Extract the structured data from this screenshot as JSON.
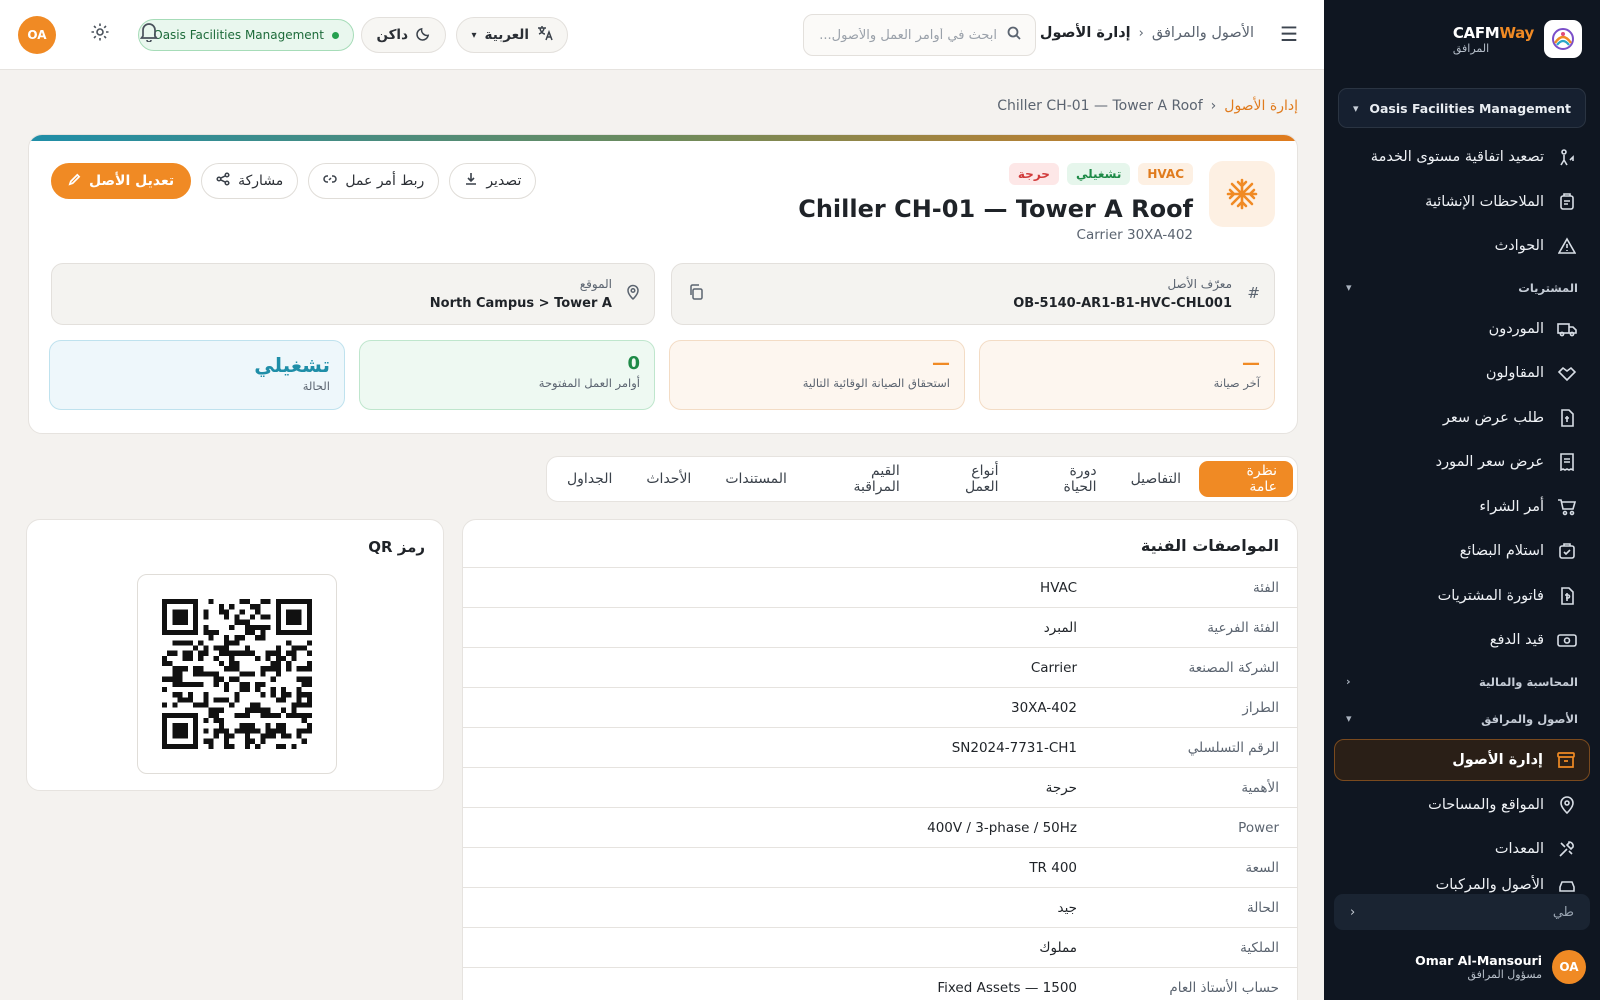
{
  "sidebar": {
    "brand_name_a": "CAFM",
    "brand_name_b": "Way",
    "brand_sub": "المرافق",
    "org": "Oasis Facilities Management",
    "items": [
      {
        "label": "تصعيد اتفاقية مستوى الخدمة",
        "icon": "escalation-icon"
      },
      {
        "label": "الملاحظات الإنشائية",
        "icon": "clipboard-icon"
      },
      {
        "label": "الحوادث",
        "icon": "warning-icon"
      }
    ],
    "section_procurement": "المشتريات",
    "procurement_items": [
      {
        "label": "الموردون",
        "icon": "truck-icon"
      },
      {
        "label": "المقاولون",
        "icon": "handshake-icon"
      },
      {
        "label": "طلب عرض سعر",
        "icon": "file-quote-icon"
      },
      {
        "label": "عرض سعر المورد",
        "icon": "receipt-icon"
      },
      {
        "label": "أمر الشراء",
        "icon": "cart-icon"
      },
      {
        "label": "استلام البضائع",
        "icon": "package-icon"
      },
      {
        "label": "فاتورة المشتريات",
        "icon": "invoice-icon"
      },
      {
        "label": "قيد الدفع",
        "icon": "payment-icon"
      }
    ],
    "section_finance": "المحاسبة والمالية",
    "section_assets": "الأصول والمرافق",
    "asset_items": [
      {
        "label": "إدارة الأصول",
        "icon": "archive-icon",
        "active": true
      },
      {
        "label": "المواقع والمساحات",
        "icon": "map-pin-icon"
      },
      {
        "label": "المعدات",
        "icon": "tools-icon"
      },
      {
        "label": "الأصول والمركبات",
        "icon": "car-icon"
      }
    ],
    "collapse_label": "طي",
    "user_initials": "OA",
    "user_name": "Omar Al-Mansouri",
    "user_role": "مسؤول المرافق"
  },
  "topbar": {
    "crumb_parent": "الأصول والمرافق",
    "crumb_current": "إدارة الأصول",
    "search_placeholder": "ابحث في أوامر العمل والأصول...",
    "language": "العربية",
    "theme": "داكن",
    "org": "Oasis Facilities Management",
    "avatar": "OA"
  },
  "page": {
    "crumb_link": "إدارة الأصول",
    "crumb_current": "Chiller CH-01 — Tower A Roof"
  },
  "asset": {
    "badge_category": "HVAC",
    "badge_status": "تشغيلي",
    "badge_criticality": "حرجة",
    "title": "Chiller CH-01 — Tower A Roof",
    "subtitle": "Carrier 30XA-402",
    "actions": {
      "edit": "تعديل الأصل",
      "share": "مشاركة",
      "link_wo": "ربط أمر عمل",
      "export": "تصدير"
    },
    "id_label": "معرّف الأصل",
    "id_value": "OB-5140-AR1-B1-HVC-CHL001",
    "location_label": "الموقع",
    "location_value": "North Campus > Tower A",
    "stats": {
      "last_maintenance_value": "—",
      "last_maintenance_label": "آخر صيانة",
      "next_pm_value": "—",
      "next_pm_label": "استحقاق الصيانة الوقائية التالية",
      "open_wo_value": "0",
      "open_wo_label": "أوامر العمل المفتوحة",
      "status_value": "تشغيلي",
      "status_label": "الحالة"
    }
  },
  "tabs": [
    "نظرة عامة",
    "التفاصيل",
    "دورة الحياة",
    "أنواع العمل",
    "القيم المراقبة",
    "المستندات",
    "الأحداث",
    "الجداول"
  ],
  "specs": {
    "title": "المواصفات الفنية",
    "rows": [
      {
        "k": "الفئة",
        "v": "HVAC"
      },
      {
        "k": "الفئة الفرعية",
        "v": "المبرد"
      },
      {
        "k": "الشركة المصنعة",
        "v": "Carrier"
      },
      {
        "k": "الطراز",
        "v": "30XA-402"
      },
      {
        "k": "الرقم التسلسلي",
        "v": "SN2024-7731-CH1"
      },
      {
        "k": "الأهمية",
        "v": "حرجة"
      },
      {
        "k": "Power",
        "v": "400V / 3-phase / 50Hz"
      },
      {
        "k": "السعة",
        "v": "TR 400"
      },
      {
        "k": "الحالة",
        "v": "جيد"
      },
      {
        "k": "الملكية",
        "v": "مملوك"
      },
      {
        "k": "حساب الأستاذ العام",
        "v": "1500 — Fixed Assets"
      }
    ]
  },
  "qr": {
    "title": "رمز QR"
  },
  "colors": {
    "accent": "#f08a24",
    "sidebar": "#0f1621",
    "success": "#1e8a47",
    "danger": "#d13a3a"
  }
}
